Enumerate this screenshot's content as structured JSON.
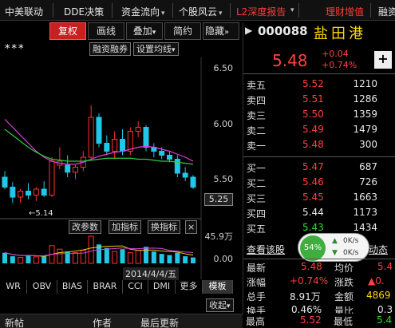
{
  "topbar": {
    "items": [
      {
        "label": "中美联动"
      },
      {
        "label": "DDE决策"
      },
      {
        "label": "资金流向"
      },
      {
        "label": "个股风云"
      },
      {
        "label": "L2深度报告"
      },
      {
        "label": "理财增值"
      },
      {
        "label": "融资"
      }
    ]
  },
  "chart_toolbar": {
    "fq": "复权",
    "hx": "画线",
    "dj": "叠加",
    "jy": "简约",
    "yc": "隐藏"
  },
  "sub_toolbar": {
    "rzrq": "融资融券",
    "sz": "设置均线",
    "stars": "***"
  },
  "chart": {
    "price_labels": [
      "6.50",
      "6.00",
      "5.50"
    ],
    "current_price_box": "5.25",
    "low_label": "5.14",
    "indicator_buttons": [
      "改参数",
      "加指标",
      "换指标"
    ],
    "indicator_close": "×",
    "vol_top": "45.9万",
    "vol_bottom": "0.00",
    "date_label": "2014/4/4/五"
  },
  "chart_data": {
    "type": "candlestick",
    "title": "",
    "y_range": [
      5.0,
      6.6
    ],
    "candles": [
      {
        "o": 5.4,
        "h": 5.46,
        "l": 5.28,
        "c": 5.3,
        "up": false
      },
      {
        "o": 5.3,
        "h": 5.35,
        "l": 5.14,
        "c": 5.2,
        "up": false
      },
      {
        "o": 5.2,
        "h": 5.28,
        "l": 5.14,
        "c": 5.26,
        "up": true
      },
      {
        "o": 5.26,
        "h": 5.34,
        "l": 5.18,
        "c": 5.22,
        "up": false
      },
      {
        "o": 5.22,
        "h": 5.3,
        "l": 5.16,
        "c": 5.28,
        "up": true
      },
      {
        "o": 5.28,
        "h": 5.36,
        "l": 5.2,
        "c": 5.22,
        "up": false
      },
      {
        "o": 5.22,
        "h": 5.6,
        "l": 5.2,
        "c": 5.56,
        "up": true
      },
      {
        "o": 5.56,
        "h": 5.7,
        "l": 5.48,
        "c": 5.52,
        "up": true
      },
      {
        "o": 5.52,
        "h": 5.62,
        "l": 5.4,
        "c": 5.45,
        "up": false
      },
      {
        "o": 5.45,
        "h": 5.52,
        "l": 5.38,
        "c": 5.5,
        "up": true
      },
      {
        "o": 5.5,
        "h": 5.66,
        "l": 5.46,
        "c": 5.6,
        "up": true
      },
      {
        "o": 5.6,
        "h": 6.12,
        "l": 5.58,
        "c": 6.0,
        "up": true
      },
      {
        "o": 6.0,
        "h": 6.04,
        "l": 5.7,
        "c": 5.74,
        "up": false
      },
      {
        "o": 5.74,
        "h": 5.82,
        "l": 5.62,
        "c": 5.66,
        "up": false
      },
      {
        "o": 5.66,
        "h": 5.86,
        "l": 5.58,
        "c": 5.78,
        "up": true
      },
      {
        "o": 5.78,
        "h": 5.88,
        "l": 5.62,
        "c": 5.66,
        "up": false
      },
      {
        "o": 5.66,
        "h": 5.9,
        "l": 5.62,
        "c": 5.86,
        "up": true
      },
      {
        "o": 5.86,
        "h": 5.96,
        "l": 5.8,
        "c": 5.9,
        "up": true
      },
      {
        "o": 5.9,
        "h": 5.92,
        "l": 5.66,
        "c": 5.7,
        "up": false
      },
      {
        "o": 5.7,
        "h": 5.74,
        "l": 5.6,
        "c": 5.66,
        "up": false
      },
      {
        "o": 5.66,
        "h": 5.7,
        "l": 5.58,
        "c": 5.62,
        "up": false
      },
      {
        "o": 5.62,
        "h": 5.66,
        "l": 5.55,
        "c": 5.58,
        "up": false
      },
      {
        "o": 5.58,
        "h": 5.62,
        "l": 5.4,
        "c": 5.44,
        "up": false
      },
      {
        "o": 5.44,
        "h": 5.5,
        "l": 5.36,
        "c": 5.4,
        "up": false
      },
      {
        "o": 5.4,
        "h": 5.42,
        "l": 5.28,
        "c": 5.3,
        "up": false
      }
    ],
    "ma_short": [
      5.98,
      5.9,
      5.82,
      5.74,
      5.66,
      5.6,
      5.56,
      5.54,
      5.53,
      5.53,
      5.55,
      5.58,
      5.61,
      5.63,
      5.65,
      5.66,
      5.68,
      5.7,
      5.71,
      5.7,
      5.68,
      5.66,
      5.63,
      5.6,
      5.56
    ],
    "ma_long": [
      5.88,
      5.82,
      5.76,
      5.7,
      5.65,
      5.61,
      5.58,
      5.57,
      5.56,
      5.56,
      5.56,
      5.57,
      5.58,
      5.59,
      5.59,
      5.59,
      5.59,
      5.58,
      5.58,
      5.57,
      5.56,
      5.56,
      5.55,
      5.54,
      5.53
    ],
    "volumes": [
      18,
      12,
      10,
      14,
      11,
      12,
      30,
      24,
      20,
      18,
      22,
      45.9,
      32,
      26,
      20,
      24,
      18,
      22,
      28,
      20,
      16,
      14,
      18,
      12,
      10
    ],
    "vol_range": [
      0,
      45.9
    ]
  },
  "bottom_tabs": [
    "WR",
    "OBV",
    "BIAS",
    "BRAR",
    "CCI",
    "DMI",
    "更多",
    "模板"
  ],
  "collapse": "收起",
  "status": {
    "new_post": "新帖",
    "author": "作者",
    "last_update": "最后更新"
  },
  "quote": {
    "code": "000088",
    "name": "盐田港",
    "price": "5.48",
    "change": "+0.04",
    "change_pct": "+0.74%",
    "add": "+"
  },
  "orderbook": {
    "sells": [
      {
        "label": "卖五",
        "price": "5.52",
        "vol": "1210"
      },
      {
        "label": "卖四",
        "price": "5.51",
        "vol": "1286"
      },
      {
        "label": "卖三",
        "price": "5.50",
        "vol": "1359"
      },
      {
        "label": "卖二",
        "price": "5.49",
        "vol": "1479"
      },
      {
        "label": "卖一",
        "price": "5.48",
        "vol": "300"
      }
    ],
    "buys": [
      {
        "label": "买一",
        "price": "5.47",
        "vol": "687"
      },
      {
        "label": "买二",
        "price": "5.46",
        "vol": "726"
      },
      {
        "label": "买三",
        "price": "5.45",
        "vol": "1663"
      },
      {
        "label": "买四",
        "price": "5.44",
        "vol": "1173"
      },
      {
        "label": "买五",
        "price": "5.43",
        "vol": "1434"
      }
    ]
  },
  "link_text": "查看该股",
  "link_text2": "动态",
  "speed": {
    "pct": "54%",
    "up": "0K/s",
    "down": "0K/s"
  },
  "stats": [
    {
      "l1": "最新",
      "v1": "5.48",
      "l2": "均价",
      "v2": "5.4"
    },
    {
      "l1": "涨幅",
      "v1": "+0.74%",
      "l2": "涨跌",
      "v2": "▲0."
    },
    {
      "l1": "总手",
      "v1": "8.91万",
      "l2": "金额",
      "v2": "4869"
    },
    {
      "l1": "换手",
      "v1": "0.46%",
      "l2": "量比",
      "v2": "0.3"
    },
    {
      "l1": "最高",
      "v1": "5.52",
      "l2": "最低",
      "v2": "5.4"
    }
  ]
}
